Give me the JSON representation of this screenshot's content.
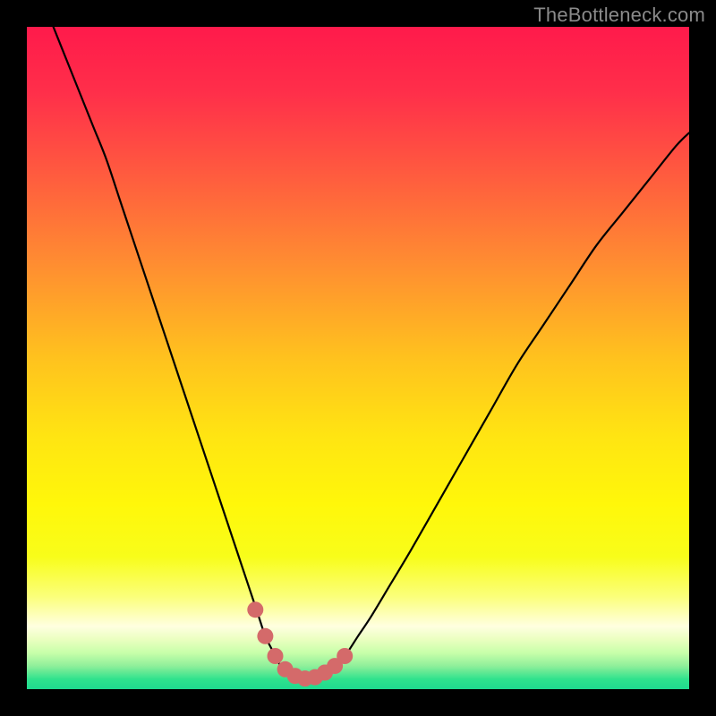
{
  "watermark": "TheBottleneck.com",
  "colors": {
    "gradient_stops": [
      {
        "offset": 0.0,
        "hex": "#ff1a4b"
      },
      {
        "offset": 0.1,
        "hex": "#ff2f4a"
      },
      {
        "offset": 0.22,
        "hex": "#ff5a3f"
      },
      {
        "offset": 0.35,
        "hex": "#ff8a32"
      },
      {
        "offset": 0.5,
        "hex": "#ffc21e"
      },
      {
        "offset": 0.62,
        "hex": "#ffe512"
      },
      {
        "offset": 0.72,
        "hex": "#fff70a"
      },
      {
        "offset": 0.8,
        "hex": "#f8fd1a"
      },
      {
        "offset": 0.86,
        "hex": "#fbff7a"
      },
      {
        "offset": 0.905,
        "hex": "#ffffe0"
      },
      {
        "offset": 0.925,
        "hex": "#eaffc0"
      },
      {
        "offset": 0.945,
        "hex": "#c8ffaa"
      },
      {
        "offset": 0.965,
        "hex": "#8fef9a"
      },
      {
        "offset": 0.985,
        "hex": "#2fe28d"
      },
      {
        "offset": 1.0,
        "hex": "#1fd98f"
      }
    ],
    "curve_stroke": "#000000",
    "marker_fill": "#d46a6a",
    "marker_stroke": "#b24f4f"
  },
  "chart_data": {
    "type": "line",
    "title": "",
    "xlabel": "",
    "ylabel": "",
    "x_range": [
      0,
      100
    ],
    "y_range": [
      0,
      100
    ],
    "grid": false,
    "legend": false,
    "series": [
      {
        "name": "bottleneck-curve",
        "x": [
          4,
          6,
          8,
          10,
          12,
          14,
          16,
          18,
          20,
          22,
          24,
          26,
          28,
          30,
          32,
          33,
          34,
          35,
          36,
          37,
          38,
          39,
          40,
          41,
          42,
          43,
          44,
          45,
          46,
          48,
          50,
          52,
          55,
          58,
          62,
          66,
          70,
          74,
          78,
          82,
          86,
          90,
          94,
          98,
          100
        ],
        "y": [
          100,
          95,
          90,
          85,
          80,
          74,
          68,
          62,
          56,
          50,
          44,
          38,
          32,
          26,
          20,
          17,
          14,
          11,
          8,
          6,
          4,
          2.8,
          2,
          1.6,
          1.4,
          1.4,
          1.6,
          2,
          3,
          5,
          8,
          11,
          16,
          21,
          28,
          35,
          42,
          49,
          55,
          61,
          67,
          72,
          77,
          82,
          84
        ]
      }
    ],
    "markers": {
      "name": "highlight-dots",
      "x": [
        34.5,
        36,
        37.5,
        39,
        40.5,
        42,
        43.5,
        45,
        46.5,
        48
      ],
      "y": [
        12,
        8,
        5,
        3,
        2,
        1.6,
        1.8,
        2.5,
        3.5,
        5
      ]
    },
    "marker_radius_px": 9,
    "curve_stroke_px": 2.2
  }
}
